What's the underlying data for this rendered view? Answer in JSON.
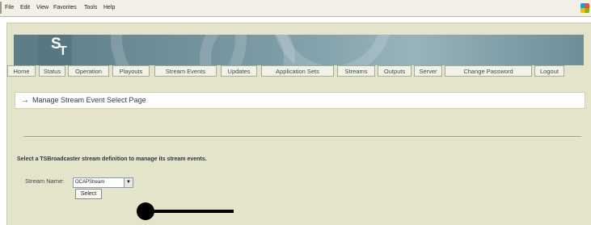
{
  "menubar": {
    "items": [
      "File",
      "Edit",
      "View",
      "Favorites",
      "Tools",
      "Help"
    ]
  },
  "banner": {
    "logo_s": "S",
    "logo_t": "T"
  },
  "nav": {
    "tabs": [
      "Home",
      "Status",
      "Operation",
      "Playouts",
      "Stream Events",
      "Updates",
      "Application Sets",
      "Streams",
      "Outputs",
      "Server",
      "Change Password",
      "Logout"
    ]
  },
  "page": {
    "title": "Manage Stream Event Select Page",
    "arrow": "→",
    "instruction": "Select a TSBroadcaster stream definition to manage its stream events.",
    "stream_label": "Stream Name:",
    "stream_value": "OCAPStream",
    "select_button": "Select"
  },
  "colors": {
    "page_background": "#e3e4c9",
    "banner": "#7c9ba5",
    "tab_background": "#f1f2e6",
    "tab_text": "#3c4b57"
  }
}
